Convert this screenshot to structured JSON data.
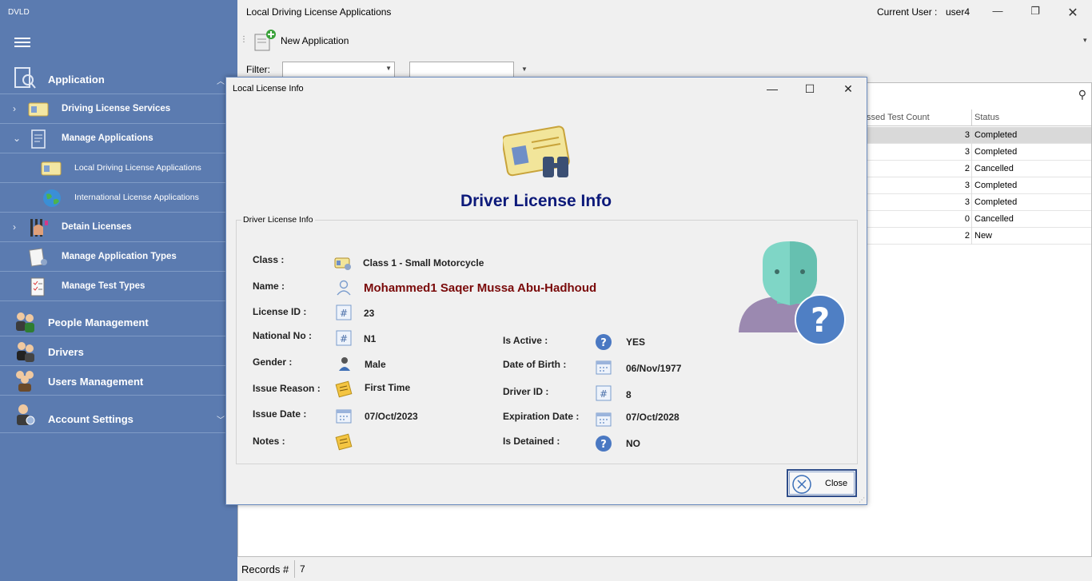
{
  "app": {
    "title": "DVLD"
  },
  "sidebar": {
    "groups": [
      {
        "label": "Application"
      },
      {
        "label": "People Management"
      },
      {
        "label": "Drivers"
      },
      {
        "label": "Users Management"
      },
      {
        "label": "Account Settings"
      }
    ],
    "items": [
      {
        "label": "Driving License Services"
      },
      {
        "label": "Manage Applications"
      },
      {
        "label": "Local Driving License Applications"
      },
      {
        "label": "International License Applications"
      },
      {
        "label": "Detain Licenses"
      },
      {
        "label": "Manage Application Types"
      },
      {
        "label": "Manage Test Types"
      }
    ]
  },
  "main": {
    "title": "Local Driving License Applications",
    "current_user_label": "Current User :",
    "current_user": "user4",
    "new_application_label": "New Application",
    "filter_label": "Filter:",
    "columns": {
      "passed_test_count": "ssed Test Count",
      "status": "Status"
    },
    "rows": [
      {
        "count": "3",
        "status": "Completed"
      },
      {
        "count": "3",
        "status": "Completed"
      },
      {
        "count": "2",
        "status": "Cancelled"
      },
      {
        "count": "3",
        "status": "Completed"
      },
      {
        "count": "3",
        "status": "Completed"
      },
      {
        "count": "0",
        "status": "Cancelled"
      },
      {
        "count": "2",
        "status": "New"
      }
    ],
    "records_label": "Records #",
    "records_count": "7"
  },
  "dialog": {
    "title": "Local License Info",
    "heading": "Driver License Info",
    "group_title": "Driver License Info",
    "fields": {
      "class": {
        "label": "Class :",
        "value": "Class 1 - Small Motorcycle"
      },
      "name": {
        "label": "Name :",
        "value": "Mohammed1 Saqer Mussa Abu-Hadhoud"
      },
      "license_id": {
        "label": "License ID :",
        "value": "23"
      },
      "national_no": {
        "label": "National No :",
        "value": "N1"
      },
      "gender": {
        "label": "Gender :",
        "value": "Male"
      },
      "issue_reason": {
        "label": "Issue Reason :",
        "value": "First Time"
      },
      "issue_date": {
        "label": "Issue Date :",
        "value": "07/Oct/2023"
      },
      "notes": {
        "label": "Notes :",
        "value": ""
      },
      "is_active": {
        "label": "Is Active :",
        "value": "YES"
      },
      "date_of_birth": {
        "label": "Date of Birth :",
        "value": "06/Nov/1977"
      },
      "driver_id": {
        "label": "Driver ID :",
        "value": "8"
      },
      "expiration_date": {
        "label": "Expiration Date :",
        "value": "07/Oct/2028"
      },
      "is_detained": {
        "label": "Is Detained :",
        "value": "NO"
      }
    },
    "close_label": "Close"
  },
  "icons": [
    "menu-icon",
    "application-icon",
    "license-card-icon",
    "manage-applications-icon",
    "globe-icon",
    "detain-hand-icon",
    "application-types-icon",
    "test-types-icon",
    "people-icon",
    "drivers-icon",
    "users-icon",
    "account-settings-icon",
    "new-application-icon",
    "search-icon",
    "question-icon",
    "calendar-icon",
    "id-number-icon",
    "person-icon",
    "notes-icon",
    "close-circle-icon"
  ],
  "colors": {
    "sidebar": "#5b7bb0",
    "heading": "#0d1a7a",
    "name_value": "#7a0a0a",
    "accent_border": "#2f4d8a"
  }
}
